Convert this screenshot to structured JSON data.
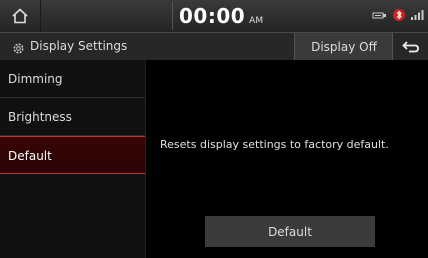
{
  "status": {
    "time": "00:00",
    "ampm": "AM"
  },
  "header": {
    "title": "Display Settings",
    "display_off_label": "Display Off"
  },
  "sidebar": {
    "items": [
      {
        "label": "Dimming"
      },
      {
        "label": "Brightness"
      },
      {
        "label": "Default"
      }
    ]
  },
  "main": {
    "description": "Resets display settings to factory default.",
    "default_button_label": "Default"
  },
  "colors": {
    "active_accent": "#b33333",
    "background": "#000000"
  },
  "icons": {
    "home": "home-icon",
    "gear": "gear-icon",
    "back": "back-arrow-icon",
    "status": [
      "usb-icon",
      "bluetooth-icon",
      "signal-icon"
    ]
  }
}
